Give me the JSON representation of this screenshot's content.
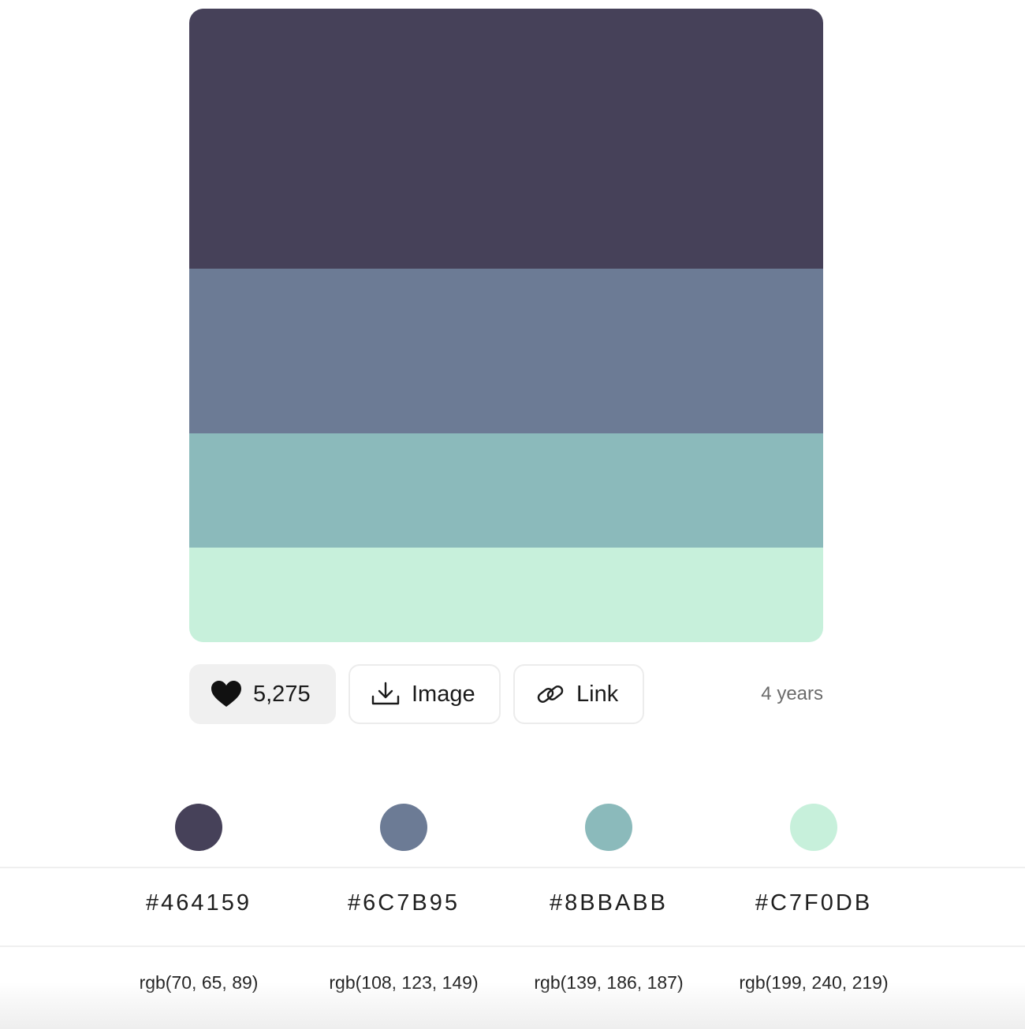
{
  "palette": {
    "colors": [
      "#464159",
      "#6C7B95",
      "#8BBABB",
      "#C7F0DB"
    ]
  },
  "actions": {
    "likes": "5,275",
    "image_label": "Image",
    "link_label": "Link",
    "age": "4 years"
  },
  "swatches": [
    {
      "hex": "#464159",
      "rgb": "rgb(70, 65, 89)"
    },
    {
      "hex": "#6C7B95",
      "rgb": "rgb(108, 123, 149)"
    },
    {
      "hex": "#8BBABB",
      "rgb": "rgb(139, 186, 187)"
    },
    {
      "hex": "#C7F0DB",
      "rgb": "rgb(199, 240, 219)"
    }
  ]
}
